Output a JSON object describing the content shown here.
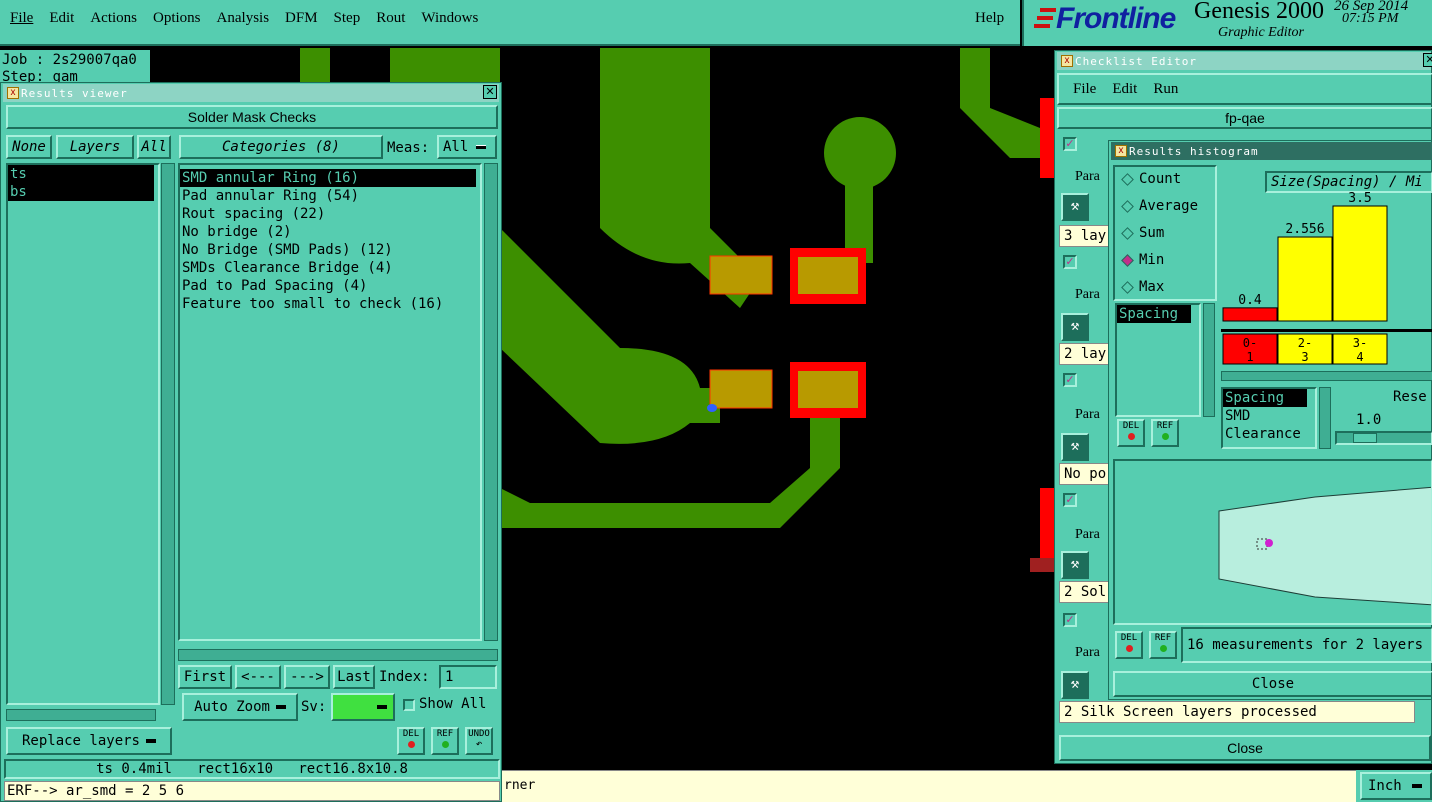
{
  "menubar": {
    "items": [
      "File",
      "Edit",
      "Actions",
      "Options",
      "Analysis",
      "DFM",
      "Step",
      "Rout",
      "Windows"
    ],
    "help": "Help"
  },
  "brand": {
    "logo": "Frontline",
    "product": "Genesis 2000",
    "subtitle": "Graphic Editor",
    "date": "26 Sep 2014",
    "time": "07:15 PM"
  },
  "job": {
    "job_line": "Job : 2s29007qa0",
    "step_line": "Step: gam"
  },
  "results_viewer": {
    "title": "Results viewer",
    "header": "Solder Mask Checks",
    "layer_buttons": {
      "none": "None",
      "layers": "Layers",
      "all": "All"
    },
    "layers": [
      "ts",
      "bs"
    ],
    "categories_button": "Categories (8)",
    "meas_label": "Meas:",
    "meas_value": "All",
    "categories": [
      "SMD annular Ring (16)",
      "Pad annular Ring (54)",
      "Rout spacing (22)",
      "No bridge (2)",
      "No Bridge (SMD Pads) (12)",
      "SMDs Clearance Bridge (4)",
      "Pad to Pad Spacing (4)",
      "Feature too small to check (16)"
    ],
    "nav": {
      "first": "First",
      "prev": "<---",
      "next": "--->",
      "last": "Last",
      "index_label": "Index:",
      "index_value": "1"
    },
    "auto_zoom": "Auto Zoom",
    "sv_label": "Sv:",
    "show_all": "Show All",
    "replace_layers": "Replace layers",
    "status": "ts 0.4mil   rect16x10   rect16.8x10.8",
    "erf": "ERF--> ar_smd = 2 5 6"
  },
  "checklist_editor": {
    "title": "Checklist Editor",
    "menu": [
      "File",
      "Edit",
      "Run"
    ],
    "name": "fp-qae",
    "rows": [
      {
        "label": "Para",
        "info": "3 lay"
      },
      {
        "label": "Para",
        "info": "2 lay"
      },
      {
        "label": "Para",
        "info": "No po"
      },
      {
        "label": "Para",
        "info": "2 Sol"
      },
      {
        "label": "Para",
        "info": ""
      }
    ],
    "status": "2 Silk Screen layers processed",
    "close": "Close"
  },
  "histogram": {
    "title": "Results histogram",
    "options": [
      "Count",
      "Average",
      "Sum",
      "Min",
      "Max"
    ],
    "selected_option": "Min",
    "attr_list": [
      "Spacing"
    ],
    "header": "Size(Spacing) / Mi",
    "res_label": "Rese",
    "res_value": "1.0",
    "legend_list": [
      "Spacing",
      "SMD",
      "Clearance"
    ],
    "summary": "16 measurements for 2 layers",
    "close": "Close"
  },
  "chart_data": {
    "type": "bar",
    "categories": [
      "0-1",
      "2-3",
      "3-4"
    ],
    "values": [
      0.4,
      2.556,
      3.5
    ],
    "value_labels": [
      "0.4",
      "2.556",
      "3.5"
    ],
    "colors": [
      "#ff0000",
      "#ffff00",
      "#ffff00"
    ],
    "ylim": [
      0,
      3.5
    ]
  },
  "bottom_bar": {
    "message": "rner",
    "unit": "Inch"
  },
  "colors": {
    "teal": "#56cdb0",
    "copper": "#3d8f00",
    "pad": "#b89a00",
    "error": "#ff0000"
  }
}
